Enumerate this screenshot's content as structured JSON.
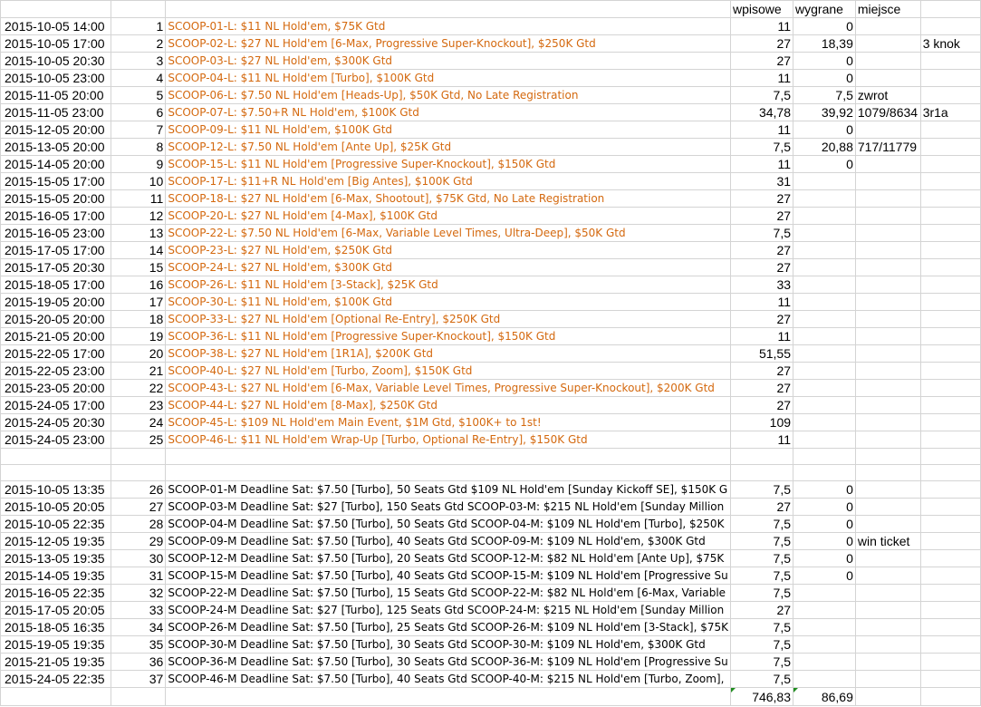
{
  "headers": {
    "wpisowe": "wpisowe",
    "wygrane": "wygrane",
    "miejsce": "miejsce"
  },
  "rows": [
    {
      "date": "2015-10-05 14:00",
      "num": "1",
      "name": "SCOOP-01-L: $11 NL Hold'em, $75K Gtd",
      "wpisowe": "11",
      "wygrane": "0",
      "miejsce": "",
      "extra": "",
      "orange": true
    },
    {
      "date": "2015-10-05 17:00",
      "num": "2",
      "name": "SCOOP-02-L: $27 NL Hold'em [6-Max, Progressive Super-Knockout], $250K Gtd",
      "wpisowe": "27",
      "wygrane": "18,39",
      "miejsce": "",
      "extra": "3 knok",
      "orange": true
    },
    {
      "date": "2015-10-05 20:30",
      "num": "3",
      "name": "SCOOP-03-L: $27 NL Hold'em, $300K Gtd",
      "wpisowe": "27",
      "wygrane": "0",
      "miejsce": "",
      "extra": "",
      "orange": true
    },
    {
      "date": "2015-10-05 23:00",
      "num": "4",
      "name": "SCOOP-04-L: $11 NL Hold'em [Turbo], $100K Gtd",
      "wpisowe": "11",
      "wygrane": "0",
      "miejsce": "",
      "extra": "",
      "orange": true
    },
    {
      "date": "2015-11-05 20:00",
      "num": "5",
      "name": "SCOOP-06-L: $7.50 NL Hold'em [Heads-Up], $50K Gtd, No Late Registration",
      "wpisowe": "7,5",
      "wygrane": "7,5",
      "miejsce": "zwrot",
      "extra": "",
      "orange": true
    },
    {
      "date": "2015-11-05 23:00",
      "num": "6",
      "name": "SCOOP-07-L: $7.50+R NL Hold'em, $100K Gtd",
      "wpisowe": "34,78",
      "wygrane": "39,92",
      "miejsce": "1079/8634",
      "extra": "3r1a",
      "orange": true
    },
    {
      "date": "2015-12-05 20:00",
      "num": "7",
      "name": "SCOOP-09-L: $11 NL Hold'em, $100K Gtd",
      "wpisowe": "11",
      "wygrane": "0",
      "miejsce": "",
      "extra": "",
      "orange": true
    },
    {
      "date": "2015-13-05 20:00",
      "num": "8",
      "name": "SCOOP-12-L: $7.50 NL Hold'em [Ante Up], $25K Gtd",
      "wpisowe": "7,5",
      "wygrane": "20,88",
      "miejsce": "717/11779",
      "extra": "",
      "orange": true
    },
    {
      "date": "2015-14-05 20:00",
      "num": "9",
      "name": "SCOOP-15-L: $11 NL Hold'em [Progressive Super-Knockout], $150K Gtd",
      "wpisowe": "11",
      "wygrane": "0",
      "miejsce": "",
      "extra": "",
      "orange": true
    },
    {
      "date": "2015-15-05 17:00",
      "num": "10",
      "name": "SCOOP-17-L: $11+R NL Hold'em [Big Antes], $100K Gtd",
      "wpisowe": "31",
      "wygrane": "",
      "miejsce": "",
      "extra": "",
      "orange": true
    },
    {
      "date": "2015-15-05 20:00",
      "num": "11",
      "name": "SCOOP-18-L: $27 NL Hold'em [6-Max, Shootout], $75K Gtd, No Late Registration",
      "wpisowe": "27",
      "wygrane": "",
      "miejsce": "",
      "extra": "",
      "orange": true
    },
    {
      "date": "2015-16-05 17:00",
      "num": "12",
      "name": "SCOOP-20-L: $27 NL Hold'em [4-Max], $100K Gtd",
      "wpisowe": "27",
      "wygrane": "",
      "miejsce": "",
      "extra": "",
      "orange": true
    },
    {
      "date": "2015-16-05 23:00",
      "num": "13",
      "name": "SCOOP-22-L: $7.50 NL Hold'em [6-Max, Variable Level Times, Ultra-Deep], $50K Gtd",
      "wpisowe": "7,5",
      "wygrane": "",
      "miejsce": "",
      "extra": "",
      "orange": true
    },
    {
      "date": "2015-17-05 17:00",
      "num": "14",
      "name": "SCOOP-23-L: $27 NL Hold'em, $250K Gtd",
      "wpisowe": "27",
      "wygrane": "",
      "miejsce": "",
      "extra": "",
      "orange": true
    },
    {
      "date": "2015-17-05 20:30",
      "num": "15",
      "name": "SCOOP-24-L: $27 NL Hold'em, $300K Gtd",
      "wpisowe": "27",
      "wygrane": "",
      "miejsce": "",
      "extra": "",
      "orange": true
    },
    {
      "date": "2015-18-05 17:00",
      "num": "16",
      "name": "SCOOP-26-L: $11 NL Hold'em [3-Stack], $25K Gtd",
      "wpisowe": "33",
      "wygrane": "",
      "miejsce": "",
      "extra": "",
      "orange": true
    },
    {
      "date": "2015-19-05 20:00",
      "num": "17",
      "name": "SCOOP-30-L: $11 NL Hold'em, $100K Gtd",
      "wpisowe": "11",
      "wygrane": "",
      "miejsce": "",
      "extra": "",
      "orange": true
    },
    {
      "date": "2015-20-05 20:00",
      "num": "18",
      "name": "SCOOP-33-L: $27 NL Hold'em [Optional Re-Entry], $250K Gtd",
      "wpisowe": "27",
      "wygrane": "",
      "miejsce": "",
      "extra": "",
      "orange": true
    },
    {
      "date": "2015-21-05 20:00",
      "num": "19",
      "name": "SCOOP-36-L: $11 NL Hold'em [Progressive Super-Knockout], $150K Gtd",
      "wpisowe": "11",
      "wygrane": "",
      "miejsce": "",
      "extra": "",
      "orange": true
    },
    {
      "date": "2015-22-05 17:00",
      "num": "20",
      "name": "SCOOP-38-L: $27 NL Hold'em [1R1A], $200K Gtd",
      "wpisowe": "51,55",
      "wygrane": "",
      "miejsce": "",
      "extra": "",
      "orange": true
    },
    {
      "date": "2015-22-05 23:00",
      "num": "21",
      "name": "SCOOP-40-L: $27 NL Hold'em [Turbo, Zoom], $150K Gtd",
      "wpisowe": "27",
      "wygrane": "",
      "miejsce": "",
      "extra": "",
      "orange": true
    },
    {
      "date": "2015-23-05 20:00",
      "num": "22",
      "name": "SCOOP-43-L: $27 NL Hold'em [6-Max, Variable Level Times, Progressive Super-Knockout], $200K Gtd",
      "wpisowe": "27",
      "wygrane": "",
      "miejsce": "",
      "extra": "",
      "orange": true
    },
    {
      "date": "2015-24-05 17:00",
      "num": "23",
      "name": "SCOOP-44-L: $27 NL Hold'em [8-Max], $250K Gtd",
      "wpisowe": "27",
      "wygrane": "",
      "miejsce": "",
      "extra": "",
      "orange": true
    },
    {
      "date": "2015-24-05 20:30",
      "num": "24",
      "name": "SCOOP-45-L: $109 NL Hold'em Main Event, $1M Gtd, $100K+ to 1st!",
      "wpisowe": "109",
      "wygrane": "",
      "miejsce": "",
      "extra": "",
      "orange": true
    },
    {
      "date": "2015-24-05 23:00",
      "num": "25",
      "name": "SCOOP-46-L: $11 NL Hold'em Wrap-Up [Turbo, Optional Re-Entry], $150K Gtd",
      "wpisowe": "11",
      "wygrane": "",
      "miejsce": "",
      "extra": "",
      "orange": true
    }
  ],
  "rows2": [
    {
      "date": "2015-10-05 13:35",
      "num": "26",
      "name": "SCOOP-01-M Deadline Sat: $7.50 [Turbo], 50 Seats Gtd $109 NL Hold'em [Sunday Kickoff SE], $150K G",
      "wpisowe": "7,5",
      "wygrane": "0",
      "miejsce": "",
      "extra": "",
      "orange": false
    },
    {
      "date": "2015-10-05 20:05",
      "num": "27",
      "name": "SCOOP-03-M Deadline Sat: $27 [Turbo], 150 Seats Gtd SCOOP-03-M: $215 NL Hold'em [Sunday Million",
      "wpisowe": "27",
      "wygrane": "0",
      "miejsce": "",
      "extra": "",
      "orange": false
    },
    {
      "date": "2015-10-05 22:35",
      "num": "28",
      "name": "SCOOP-04-M Deadline Sat: $7.50 [Turbo], 50 Seats Gtd SCOOP-04-M: $109 NL Hold'em [Turbo], $250K",
      "wpisowe": "7,5",
      "wygrane": "0",
      "miejsce": "",
      "extra": "",
      "orange": false
    },
    {
      "date": "2015-12-05 19:35",
      "num": "29",
      "name": "SCOOP-09-M Deadline Sat: $7.50 [Turbo], 40 Seats Gtd SCOOP-09-M: $109 NL Hold'em, $300K Gtd",
      "wpisowe": "7,5",
      "wygrane": "0",
      "miejsce": "win ticket",
      "extra": "",
      "orange": false
    },
    {
      "date": "2015-13-05 19:35",
      "num": "30",
      "name": "SCOOP-12-M Deadline Sat: $7.50 [Turbo], 20 Seats Gtd SCOOP-12-M: $82 NL Hold'em [Ante Up], $75K",
      "wpisowe": "7,5",
      "wygrane": "0",
      "miejsce": "",
      "extra": "",
      "orange": false
    },
    {
      "date": "2015-14-05 19:35",
      "num": "31",
      "name": "SCOOP-15-M Deadline Sat: $7.50 [Turbo], 40 Seats Gtd SCOOP-15-M: $109 NL Hold'em [Progressive Su",
      "wpisowe": "7,5",
      "wygrane": "0",
      "miejsce": "",
      "extra": "",
      "orange": false
    },
    {
      "date": "2015-16-05 22:35",
      "num": "32",
      "name": "SCOOP-22-M Deadline Sat: $7.50 [Turbo], 15 Seats Gtd SCOOP-22-M: $82 NL Hold'em [6-Max, Variable",
      "wpisowe": "7,5",
      "wygrane": "",
      "miejsce": "",
      "extra": "",
      "orange": false
    },
    {
      "date": "2015-17-05 20:05",
      "num": "33",
      "name": "SCOOP-24-M Deadline Sat: $27 [Turbo], 125 Seats Gtd SCOOP-24-M: $215 NL Hold'em [Sunday Million",
      "wpisowe": "27",
      "wygrane": "",
      "miejsce": "",
      "extra": "",
      "orange": false
    },
    {
      "date": "2015-18-05 16:35",
      "num": "34",
      "name": "SCOOP-26-M Deadline Sat: $7.50 [Turbo], 25 Seats Gtd SCOOP-26-M: $109 NL Hold'em [3-Stack], $75K",
      "wpisowe": "7,5",
      "wygrane": "",
      "miejsce": "",
      "extra": "",
      "orange": false
    },
    {
      "date": "2015-19-05 19:35",
      "num": "35",
      "name": "SCOOP-30-M Deadline Sat: $7.50 [Turbo], 30 Seats Gtd SCOOP-30-M: $109 NL Hold'em, $300K Gtd",
      "wpisowe": "7,5",
      "wygrane": "",
      "miejsce": "",
      "extra": "",
      "orange": false
    },
    {
      "date": "2015-21-05 19:35",
      "num": "36",
      "name": "SCOOP-36-M Deadline Sat: $7.50 [Turbo], 30 Seats Gtd SCOOP-36-M: $109 NL Hold'em [Progressive Su",
      "wpisowe": "7,5",
      "wygrane": "",
      "miejsce": "",
      "extra": "",
      "orange": false
    },
    {
      "date": "2015-24-05 22:35",
      "num": "37",
      "name": "SCOOP-46-M Deadline Sat: $7.50 [Turbo], 40 Seats Gtd SCOOP-40-M: $215 NL Hold'em [Turbo, Zoom],",
      "wpisowe": "7,5",
      "wygrane": "",
      "miejsce": "",
      "extra": "",
      "orange": false
    }
  ],
  "totals": {
    "wpisowe": "746,83",
    "wygrane": "86,69"
  }
}
